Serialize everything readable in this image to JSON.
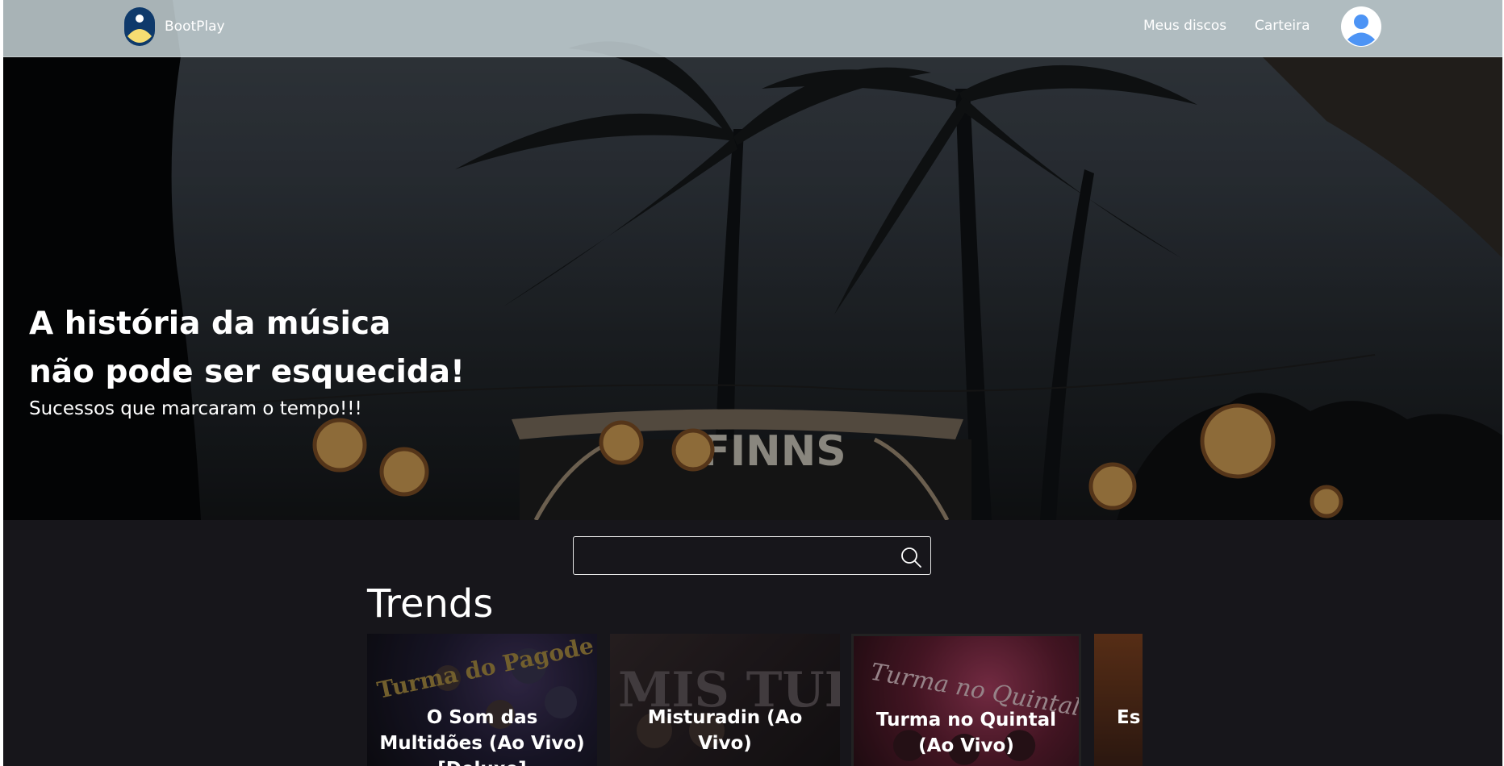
{
  "brand": {
    "name": "BootPlay"
  },
  "nav": {
    "links": [
      "Meus discos",
      "Carteira"
    ]
  },
  "hero": {
    "title_line1": "A história da música",
    "title_line2": "não pode ser esquecida!",
    "subtitle": "Sucessos que marcaram o tempo!!!",
    "sign_text": "FINNS"
  },
  "search": {
    "value": "",
    "placeholder": ""
  },
  "trends": {
    "title": "Trends",
    "albums": [
      {
        "title": "O Som das Multidões (Ao Vivo) [Deluxe]",
        "cover_text": "Turma do Pagode"
      },
      {
        "title": "Misturadin (Ao Vivo)",
        "cover_text": "MIS TURA"
      },
      {
        "title": "Turma no Quintal (Ao Vivo)",
        "cover_text": "Turma no Quintal"
      },
      {
        "title": "Es",
        "cover_text": ""
      }
    ]
  },
  "colors": {
    "page_background": "#17161b",
    "navbar": "#cddade",
    "avatar_blue": "#4d94f5",
    "logo_navy": "#0f3a6b",
    "logo_yellow": "#f7dd72"
  }
}
